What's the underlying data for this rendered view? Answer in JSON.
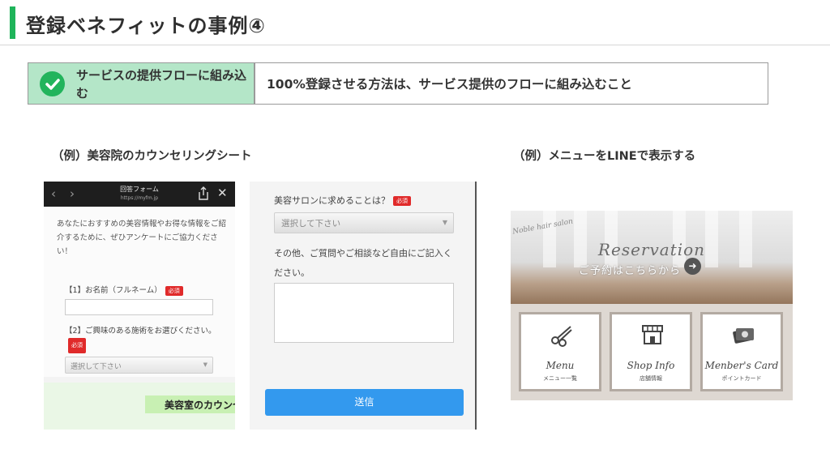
{
  "header": {
    "title": "登録ベネフィットの事例④",
    "accent_color": "#1fb45a"
  },
  "point": {
    "label": "サービスの提供フローに組み込む",
    "text": "100%登録させる方法は、サービス提供のフローに組み込むこと",
    "icon": "check-circle-icon"
  },
  "left_example": {
    "caption": "（例）美容院のカウンセリングシート",
    "form_page": {
      "title": "回答フォーム",
      "url": "https://myfm.jp",
      "intro": "あなたにおすすめの美容情報やお得な情報をご紹介するために、ぜひアンケートにご協力ください！",
      "q1": "【1】お名前（フルネーム）",
      "q2": "【2】ご興味のある施術をお選びください。",
      "required": "必須",
      "select_placeholder": "選択して下さい",
      "banner": "美容室のカウンセリング"
    },
    "form_page_2": {
      "q3": "美容サロンに求めることは？",
      "required": "必須",
      "select_placeholder": "選択して下さい",
      "q4": "その他、ご質問やご相談など自由にご記入ください。",
      "submit": "送信"
    }
  },
  "right_example": {
    "caption": "（例）メニューをLINEで表示する",
    "rich_menu": {
      "salon_name": "Noble hair salon",
      "reserve_title": "Reservation",
      "reserve_sub": "ご予約はこちらから",
      "tiles": [
        {
          "en": "Menu",
          "jp": "メニュー一覧",
          "icon": "scissors-icon"
        },
        {
          "en": "Shop Info",
          "jp": "店舗情報",
          "icon": "shop-icon"
        },
        {
          "en": "Menber's Card",
          "jp": "ポイントカード",
          "icon": "card-icon"
        }
      ]
    }
  }
}
